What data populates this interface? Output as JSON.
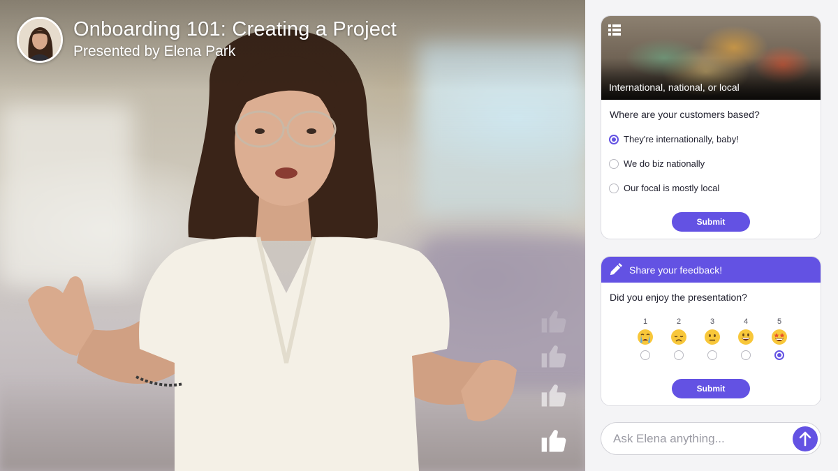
{
  "presentation": {
    "title": "Onboarding 101: Creating a Project",
    "presenter": "Presented by Elena Park"
  },
  "reactions": {
    "icon": "thumbs-up-icon"
  },
  "poll": {
    "caption": "International, national, or local",
    "question": "Where are your customers based?",
    "options": [
      {
        "label": "They're internationally, baby!",
        "selected": true
      },
      {
        "label": "We do biz nationally",
        "selected": false
      },
      {
        "label": "Our focal is mostly local",
        "selected": false
      }
    ],
    "submit_label": "Submit"
  },
  "feedback": {
    "title": "Share your feedback!",
    "question": "Did you enjoy the presentation?",
    "scale": [
      {
        "value": "1",
        "emoji": "crying-face-icon",
        "selected": false
      },
      {
        "value": "2",
        "emoji": "disappointed-face-icon",
        "selected": false
      },
      {
        "value": "3",
        "emoji": "neutral-face-icon",
        "selected": false
      },
      {
        "value": "4",
        "emoji": "smiling-face-icon",
        "selected": false
      },
      {
        "value": "5",
        "emoji": "star-struck-face-icon",
        "selected": true
      }
    ],
    "submit_label": "Submit"
  },
  "ask": {
    "placeholder": "Ask Elena anything..."
  },
  "colors": {
    "accent": "#6352e3",
    "panel_bg": "#f4f4f6"
  }
}
